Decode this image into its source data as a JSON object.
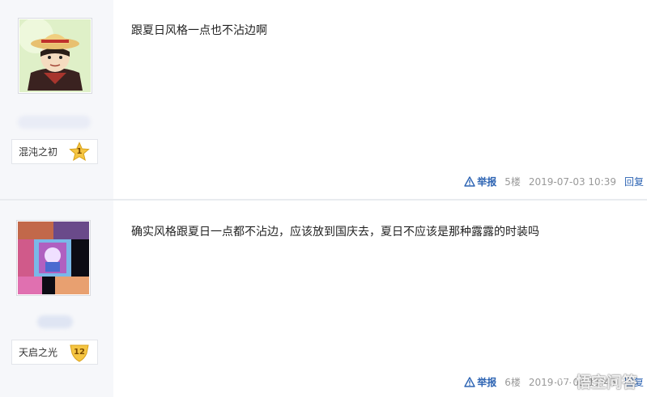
{
  "posts": [
    {
      "level_name": "混沌之初",
      "level_number": "1",
      "content": "跟夏日风格一点也不沾边啊",
      "report_label": "举报",
      "floor": "5楼",
      "timestamp": "2019-07-03 10:39",
      "reply_label": "回复"
    },
    {
      "level_name": "天启之光",
      "level_number": "12",
      "content": "确实风格跟夏日一点都不沾边，应该放到国庆去，夏日不应该是那种露露的时装吗",
      "report_label": "举报",
      "floor": "6楼",
      "timestamp": "2019-07-03 11:45",
      "reply_label": "回复"
    }
  ],
  "watermark": {
    "text": "悟空问答"
  },
  "colors": {
    "link": "#2d64b3",
    "meta_gray": "#999999",
    "user_col_bg": "#f6f7fa",
    "badge_gold": "#f5c542"
  }
}
